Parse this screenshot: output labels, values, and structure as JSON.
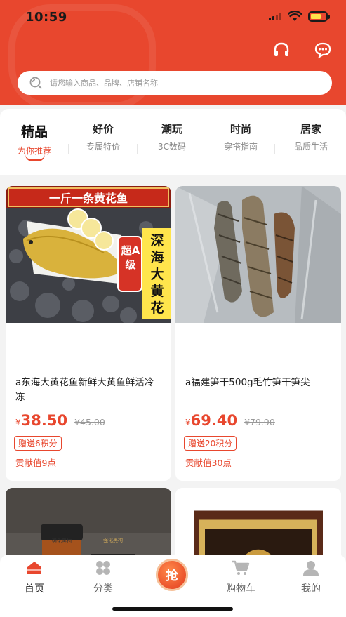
{
  "status": {
    "time": "10:59"
  },
  "header": {
    "search_placeholder": "请您输入商品、品牌、店铺名称",
    "icons": [
      "headset-icon",
      "chat-icon"
    ]
  },
  "categories": [
    {
      "title": "精品",
      "subtitle": "为你推荐",
      "active": true
    },
    {
      "title": "好价",
      "subtitle": "专属特价"
    },
    {
      "title": "潮玩",
      "subtitle": "3C数码"
    },
    {
      "title": "时尚",
      "subtitle": "穿搭指南"
    },
    {
      "title": "居家",
      "subtitle": "品质生活"
    }
  ],
  "products": [
    {
      "banner": "一斤一条黄花鱼",
      "tag1": "超A级",
      "tag2": "深海大黄花",
      "title": "a东海大黄花鱼新鲜大黄鱼鲜活冷冻",
      "currency": "¥",
      "price": "38.50",
      "old_price": "¥45.00",
      "points": "赠送6积分",
      "contribution": "贡献值9点"
    },
    {
      "title": "a福建笋干500g毛竹笋干笋尖",
      "currency": "¥",
      "price": "69.40",
      "old_price": "¥79.90",
      "points": "赠送20积分",
      "contribution": "贡献值30点"
    },
    {
      "jar_label": "强化黑枸",
      "box_label": "强化黑枸"
    },
    {}
  ],
  "tabbar": [
    {
      "label": "首页",
      "active": true
    },
    {
      "label": "分类"
    },
    {
      "label": "抢"
    },
    {
      "label": "购物车"
    },
    {
      "label": "我的"
    }
  ],
  "colors": {
    "brand": "#e8472e",
    "background": "#f3f3f3"
  }
}
